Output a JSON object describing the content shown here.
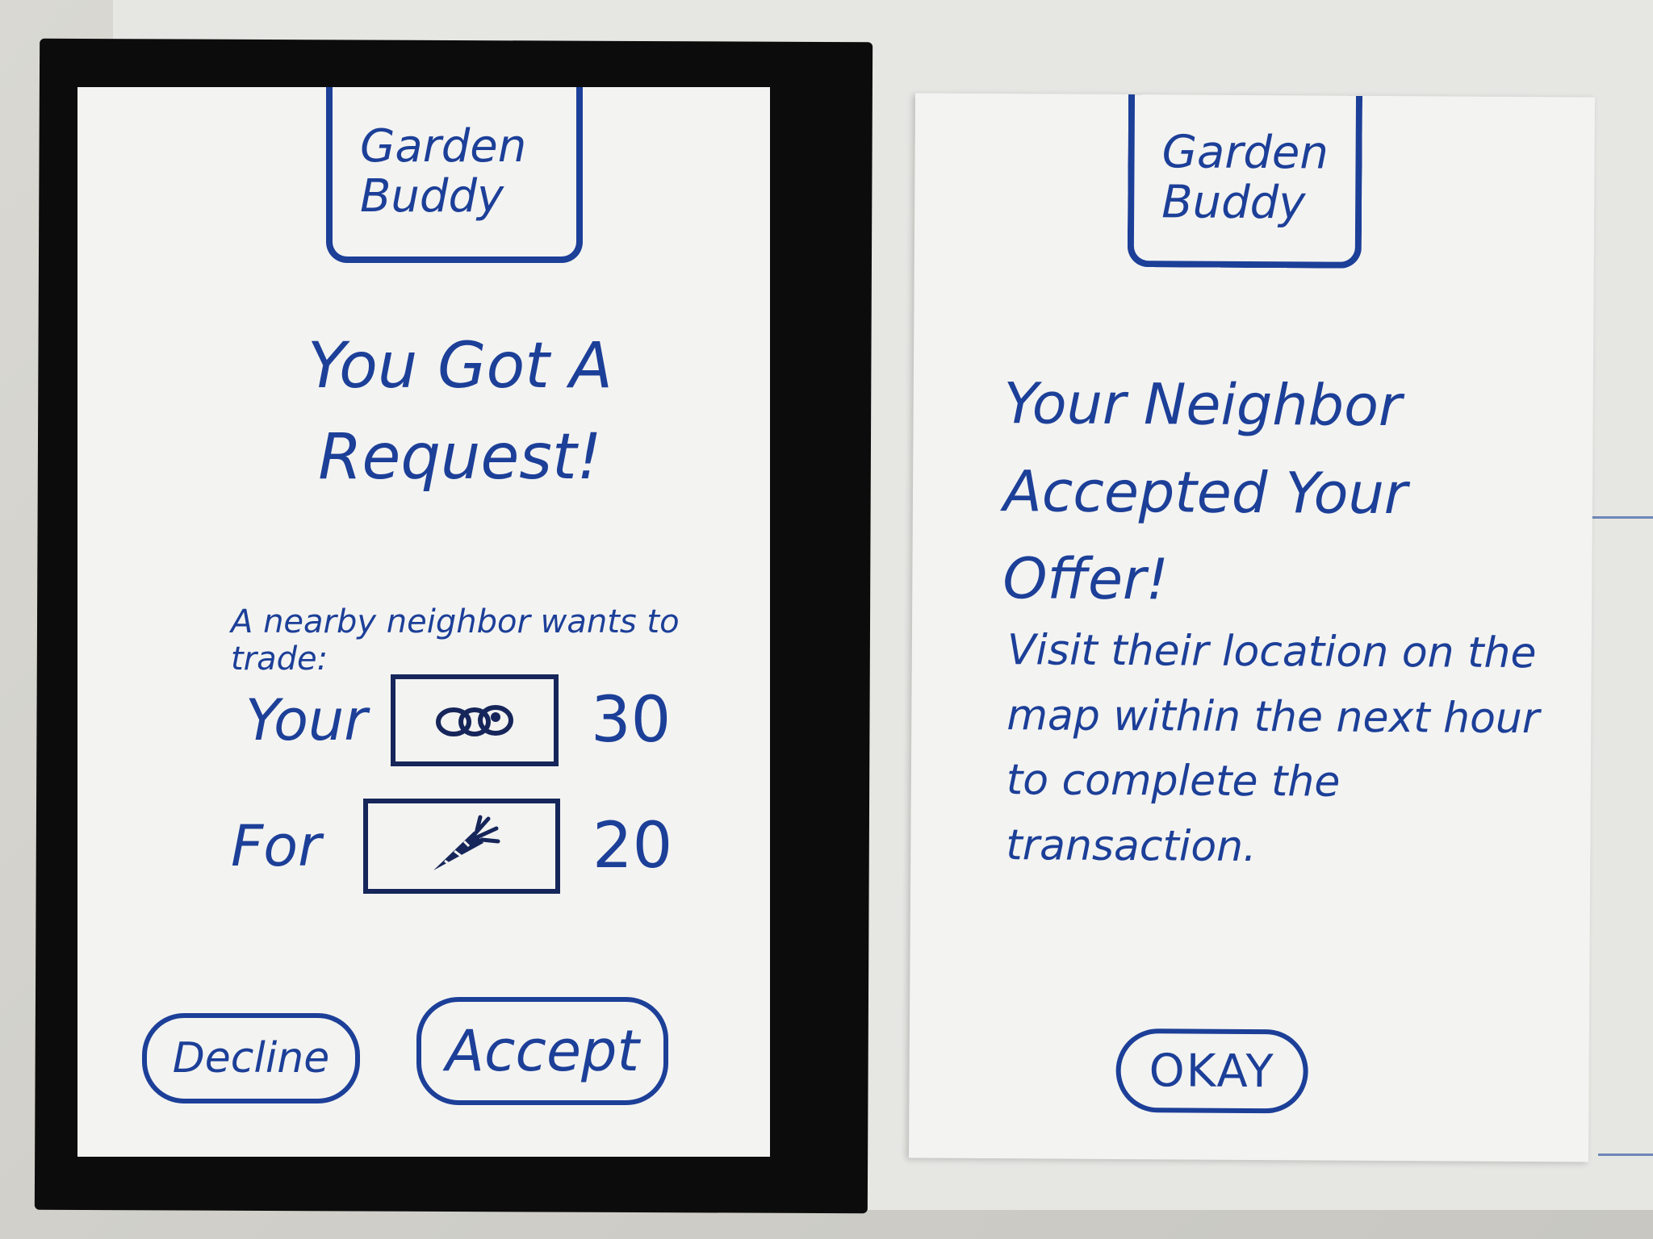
{
  "app": {
    "logo_text": "Garden Buddy"
  },
  "request_screen": {
    "title": "You Got A Request!",
    "subtitle": "A nearby neighbor wants to trade:",
    "give": {
      "label": "Your",
      "icon": "seeds-icon",
      "quantity": "30"
    },
    "get": {
      "label": "For",
      "icon": "carrot-icon",
      "quantity": "20"
    },
    "decline_label": "Decline",
    "accept_label": "Accept"
  },
  "accepted_screen": {
    "title": "Your Neighbor Accepted Your Offer!",
    "body": "Visit their location on the map within the next hour to complete the transaction.",
    "okay_label": "OKAY"
  },
  "colors": {
    "ink": "#1c3f98",
    "paper": "#f3f3f1",
    "frame": "#0c0c0c"
  }
}
